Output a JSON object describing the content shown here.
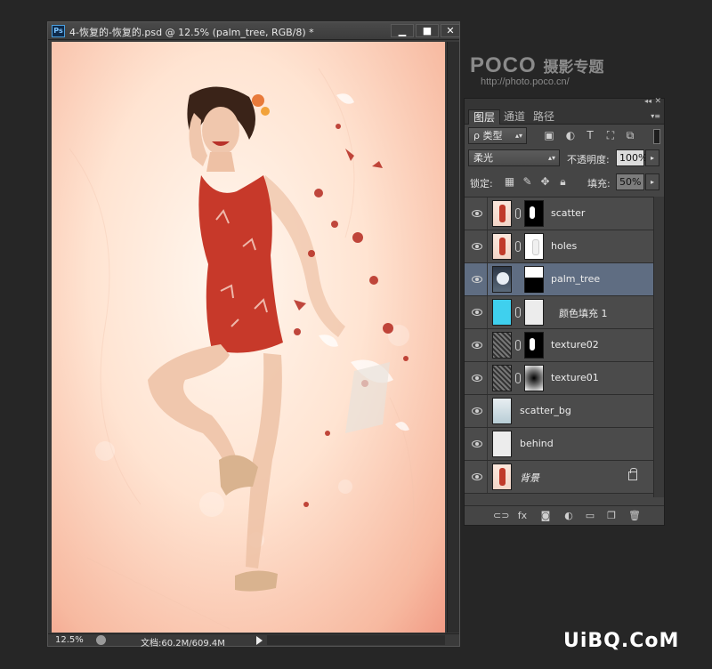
{
  "document": {
    "ps_logo": "Ps",
    "title": "4-恢复的-恢复的.psd @ 12.5% (palm_tree, RGB/8) *",
    "win_controls": [
      "▁",
      "■",
      "✕"
    ],
    "zoom": "12.5%",
    "doc_size": "文档:60.2M/609.4M"
  },
  "watermark": {
    "brand": "POCO",
    "brand_cn": "摄影专题",
    "url": "http://photo.poco.cn/"
  },
  "panel": {
    "tabs": [
      "图层",
      "通道",
      "路径"
    ],
    "active_tab": "图层",
    "filter_kind": "ρ 类型",
    "blend_mode": "柔光",
    "opacity_label": "不透明度:",
    "opacity_value": "100%",
    "lock_label": "锁定:",
    "fill_label": "填充:",
    "fill_value": "50%",
    "layers": [
      {
        "name": "scatter",
        "thumb": "woman",
        "mask": "black",
        "linked": true,
        "visible": true,
        "selected": false
      },
      {
        "name": "holes",
        "thumb": "woman",
        "mask": "white",
        "linked": true,
        "visible": true,
        "selected": false
      },
      {
        "name": "palm_tree",
        "thumb": "palm",
        "mask": "palm",
        "linked": false,
        "visible": true,
        "selected": true
      },
      {
        "name": "颜色填充 1",
        "thumb": "cyan",
        "mask": "white-solid",
        "linked": true,
        "visible": true,
        "selected": false
      },
      {
        "name": "texture02",
        "thumb": "noise",
        "mask": "black",
        "linked": true,
        "visible": true,
        "selected": false
      },
      {
        "name": "texture01",
        "thumb": "noise",
        "mask": "gradient",
        "linked": true,
        "visible": true,
        "selected": false
      },
      {
        "name": "scatter_bg",
        "thumb": "sky",
        "mask": null,
        "linked": false,
        "visible": true,
        "selected": false
      },
      {
        "name": "behind",
        "thumb": "white",
        "mask": null,
        "linked": false,
        "visible": true,
        "selected": false
      },
      {
        "name": "背景",
        "thumb": "woman",
        "mask": null,
        "linked": false,
        "visible": true,
        "selected": false,
        "locked": true
      }
    ],
    "footer_icons": [
      "link-icon",
      "fx-icon",
      "mask-icon",
      "adjustment-icon",
      "folder-icon",
      "new-layer-icon",
      "trash-icon"
    ]
  },
  "site_watermark": "UiBQ.CoM",
  "colors": {
    "selected_layer": "#5f6d82",
    "fill_layer_cyan": "#3fd0ee",
    "dress": "#c03a2a"
  }
}
